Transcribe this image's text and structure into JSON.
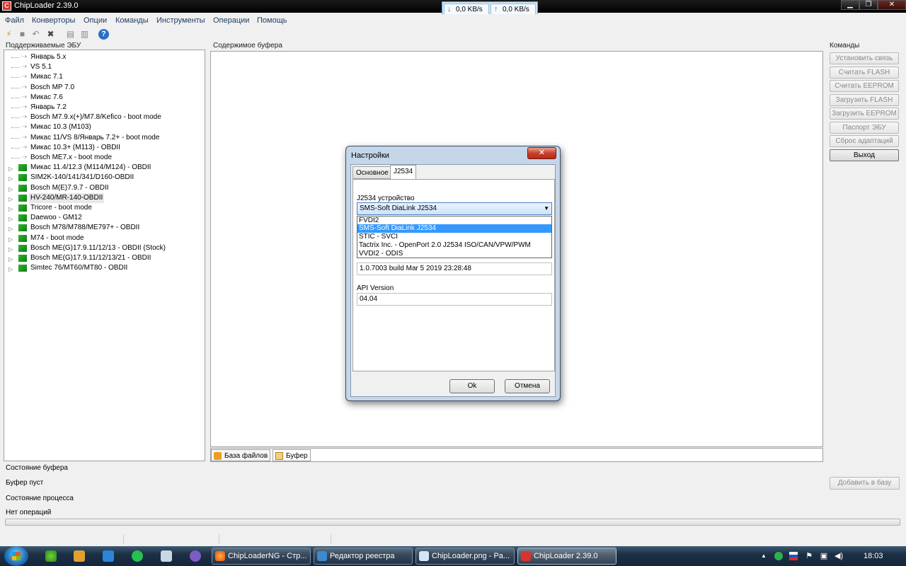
{
  "window": {
    "title": "ChipLoader 2.39.0",
    "minimize": "▁",
    "maximize": "❐",
    "close": "✕"
  },
  "netmon": {
    "down": "0,0 KB/s",
    "up": "0,0 KB/s"
  },
  "menu": [
    "Файл",
    "Конверторы",
    "Опции",
    "Команды",
    "Инструменты",
    "Операции",
    "Помощь"
  ],
  "panels": {
    "ecu_label": "Поддерживаемые ЭБУ",
    "buffer_label": "Содержимое буфера",
    "commands_label": "Команды"
  },
  "tree": [
    {
      "label": "Январь 5.x",
      "type": "leaf"
    },
    {
      "label": "VS 5.1",
      "type": "leaf"
    },
    {
      "label": "Микас 7.1",
      "type": "leaf"
    },
    {
      "label": "Bosch MP 7.0",
      "type": "leaf"
    },
    {
      "label": "Микас 7.6",
      "type": "leaf"
    },
    {
      "label": "Январь 7.2",
      "type": "leaf"
    },
    {
      "label": "Bosch M7.9.x(+)/M7.8/Kefico - boot mode",
      "type": "leaf"
    },
    {
      "label": "Микас 10.3 (M103)",
      "type": "leaf"
    },
    {
      "label": "Микас 11/VS 8/Январь 7.2+ - boot mode",
      "type": "leaf"
    },
    {
      "label": "Микас 10.3+ (M113) - OBDII",
      "type": "leaf"
    },
    {
      "label": "Bosch ME7.x - boot mode",
      "type": "leaf"
    },
    {
      "label": "Микас 11.4/12.3 (M114/M124) - OBDII",
      "type": "node"
    },
    {
      "label": "SIM2K-140/141/341/D160-OBDII",
      "type": "node"
    },
    {
      "label": "Bosch M(E)7.9.7 - OBDII",
      "type": "node"
    },
    {
      "label": "HV-240/MR-140-OBDII",
      "type": "node",
      "selected": true
    },
    {
      "label": "Tricore - boot mode",
      "type": "node"
    },
    {
      "label": "Daewoo - GM12",
      "type": "node"
    },
    {
      "label": "Bosch M78/M788/ME797+ - OBDII",
      "type": "node"
    },
    {
      "label": "M74 - boot mode",
      "type": "node"
    },
    {
      "label": "Bosch ME(G)17.9.11/12/13 - OBDII (Stock)",
      "type": "node"
    },
    {
      "label": "Bosch ME(G)17.9.11/12/13/21 - OBDII",
      "type": "node"
    },
    {
      "label": "Simtec 76/MT60/MT80 - OBDII",
      "type": "node"
    }
  ],
  "bottom_tabs": [
    "База файлов",
    "Буфер"
  ],
  "commands": [
    {
      "label": "Установить связь",
      "enabled": false
    },
    {
      "label": "Считать FLASH",
      "enabled": false
    },
    {
      "label": "Считать EEPROM",
      "enabled": false
    },
    {
      "label": "Загрузить FLASH",
      "enabled": false
    },
    {
      "label": "Загрузить EEPROM",
      "enabled": false
    },
    {
      "label": "Паспорт ЭБУ",
      "enabled": false
    },
    {
      "label": "Сброс адаптаций",
      "enabled": false
    },
    {
      "label": "Выход",
      "enabled": true
    }
  ],
  "status": {
    "buffer_label": "Состояние буфера",
    "buffer_value": "Буфер пуст",
    "add_to_base": "Добавить в базу",
    "process_label": "Состояние процесса",
    "process_value": "Нет операций"
  },
  "dialog": {
    "title": "Настройки",
    "close": "✕",
    "tabs": [
      "Основное",
      "J2534"
    ],
    "device_label": "J2534 устройство",
    "device_selected": "SMS-Soft DiaLink J2534",
    "device_options": [
      "FVDI2",
      "SMS-Soft DiaLink J2534",
      "STIC - SVCI",
      "Tactrix Inc. - OpenPort 2.0 J2534 ISO/CAN/VPW/PWM",
      "VVDI2 - ODIS"
    ],
    "version_value": "1.0.7003 build Mar  5 2019 23:28:48",
    "api_label": "API Version",
    "api_value": "04.04",
    "ok": "Ok",
    "cancel": "Отмена"
  },
  "taskbar": {
    "tasks": [
      "ChipLoaderNG - Стр...",
      "Редактор реестра",
      "ChipLoader.png - Pa...",
      "ChipLoader 2.39.0"
    ],
    "time": "18:03"
  }
}
